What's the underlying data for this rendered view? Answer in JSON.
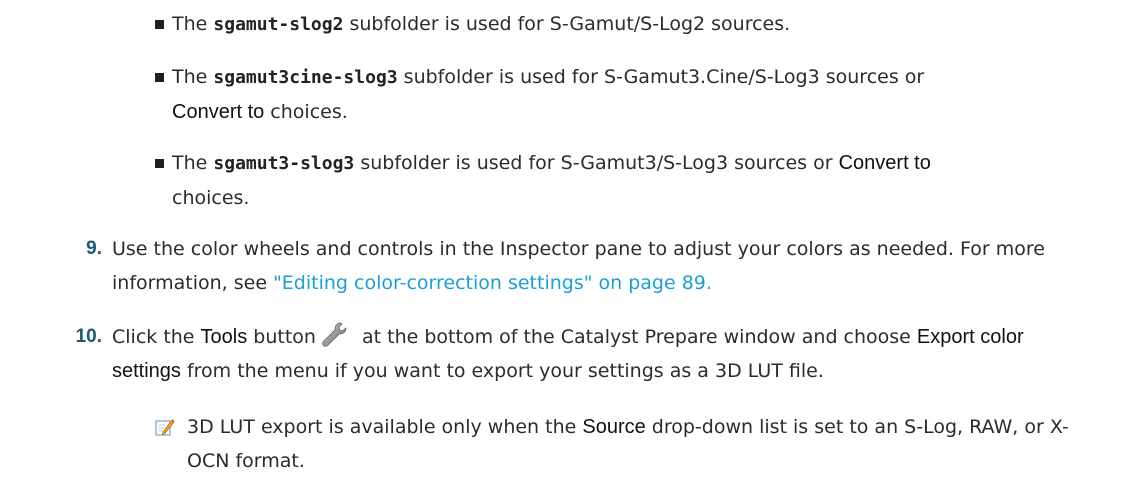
{
  "bullets": [
    {
      "prefix": "The ",
      "code": "sgamut-slog2",
      "suffix": " subfolder is used for S-Gamut/S-Log2 sources."
    },
    {
      "prefix": "The ",
      "code": "sgamut3cine-slog3",
      "mid": " subfolder is used for S-Gamut3.Cine/S-Log3 sources or",
      "ui": "Convert to",
      "suffix": " choices."
    },
    {
      "prefix": "The ",
      "code": "sgamut3-slog3",
      "mid": " subfolder is used for S-Gamut3/S-Log3 sources or ",
      "ui": "Convert to",
      "suffix": "choices."
    }
  ],
  "steps": [
    {
      "number": "9.",
      "text1": "Use the color wheels and controls in the Inspector pane to adjust your colors as needed. For more",
      "text2": "information, see ",
      "link": "\"Editing color-correction settings\" on page 89."
    },
    {
      "number": "10.",
      "pre": "Click the ",
      "ui1": "Tools",
      "mid1": " button",
      "icon": "wrench-icon",
      "mid2": " at the bottom of the Catalyst Prepare window and choose ",
      "ui2a": "Export color",
      "ui2b": "settings",
      "post": " from the menu if you want to export your settings as a 3D LUT file."
    }
  ],
  "note": {
    "icon": "note-pencil-icon",
    "pre": "3D LUT export is available only when the ",
    "ui": "Source",
    "post1": " drop-down list is set to an S-Log, RAW, or X-",
    "post2": "OCN format."
  },
  "colors": {
    "link": "#1a9fd6",
    "step_number": "#1a5a7a",
    "text": "#2b2b2b"
  }
}
